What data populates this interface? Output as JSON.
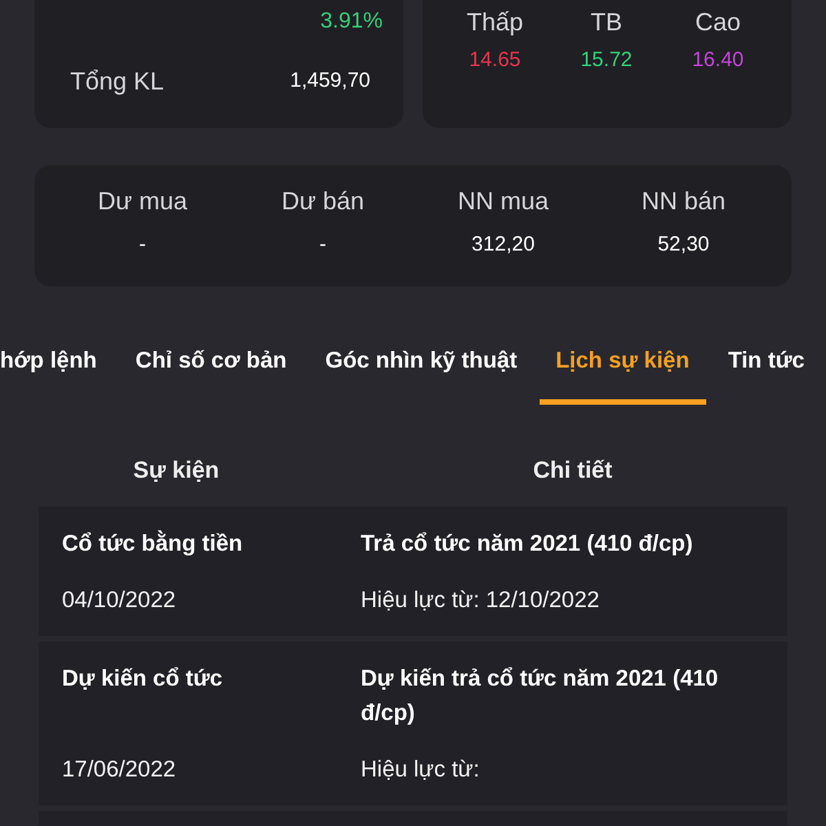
{
  "quote": {
    "change_percent": "3.91%",
    "total_volume": {
      "label": "Tổng KL",
      "value": "1,459,70"
    }
  },
  "price_range": [
    {
      "label": "Thấp",
      "value": "14.65",
      "color": "#e8354f"
    },
    {
      "label": "TB",
      "value": "15.72",
      "color": "#33d17a"
    },
    {
      "label": "Cao",
      "value": "16.40",
      "color": "#c644dc"
    }
  ],
  "market_stats": [
    {
      "label": "Dư mua",
      "value": "-"
    },
    {
      "label": "Dư bán",
      "value": "-"
    },
    {
      "label": "NN mua",
      "value": "312,20"
    },
    {
      "label": "NN bán",
      "value": "52,30"
    }
  ],
  "tabs": [
    {
      "label": "hớp lệnh",
      "selected": false
    },
    {
      "label": "Chỉ số cơ bản",
      "selected": false
    },
    {
      "label": "Góc nhìn kỹ thuật",
      "selected": false
    },
    {
      "label": "Lịch sự kiện",
      "selected": true
    },
    {
      "label": "Tin tức",
      "selected": false
    }
  ],
  "events_table": {
    "columns": [
      "Sự kiện",
      "Chi tiết"
    ],
    "rows": [
      {
        "event": "Cổ tức bằng tiền",
        "date": "04/10/2022",
        "detail": "Trả cổ tức năm 2021 (410 đ/cp)",
        "effective": "Hiệu lực từ: 12/10/2022"
      },
      {
        "event": "Dự kiến cổ tức",
        "date": "17/06/2022",
        "detail": "Dự kiến trả cổ tức năm 2021 (410 đ/cp)",
        "effective": "Hiệu lực từ:"
      }
    ]
  }
}
